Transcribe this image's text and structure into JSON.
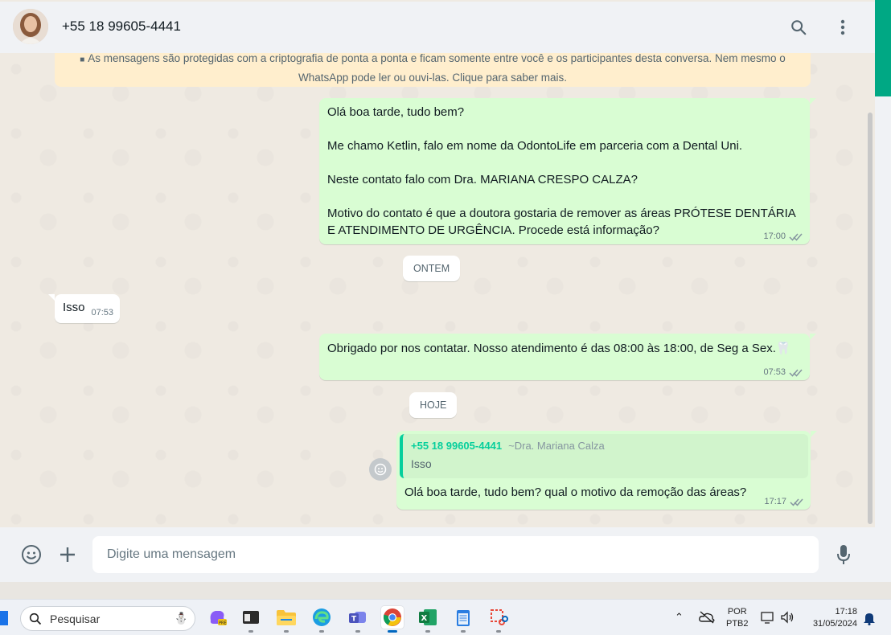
{
  "header": {
    "contact_name": "+55 18 99605-4441"
  },
  "encryption_notice": {
    "line1": "As mensagens são protegidas com a criptografia de ponta a ponta e ficam somente entre você e os participantes desta conversa. Nem mesmo o",
    "line2": "WhatsApp pode ler ou ouvi-las. Clique para saber mais."
  },
  "messages": {
    "m1": {
      "p1": "Olá boa tarde, tudo bem?",
      "p2": "Me chamo Ketlin, falo em nome da OdontoLife em parceria com a Dental Uni.",
      "p3": "Neste contato falo com Dra. MARIANA CRESPO CALZA?",
      "p4": "Motivo do contato é que a doutora gostaria de remover as áreas PRÓTESE DENTÁRIA E ATENDIMENTO DE URGÊNCIA. Procede está informação?",
      "time": "17:00"
    },
    "date1": "ONTEM",
    "m2": {
      "text": "Isso",
      "time": "07:53"
    },
    "m3": {
      "text": "Obrigado por nos contatar. Nosso atendimento é das 08:00 às 18:00, de Seg a Sex.",
      "emoji": "🦷",
      "time": "07:53"
    },
    "date2": "HOJE",
    "m4": {
      "quote_author": "+55 18 99605-4441",
      "quote_alias": "~Dra. Mariana Calza",
      "quote_text": "Isso",
      "text": "Olá boa tarde, tudo bem? qual o motivo da remoção das áreas?",
      "time": "17:17"
    }
  },
  "composer": {
    "placeholder": "Digite uma mensagem"
  },
  "taskbar": {
    "search_label": "Pesquisar",
    "lang_top": "POR",
    "lang_bottom": "PTB2",
    "clock_time": "17:18",
    "clock_date": "31/05/2024"
  },
  "colors": {
    "accent": "#00a884",
    "outgoing_bubble": "#d9fdd3",
    "incoming_bubble": "#ffffff",
    "notice_bg": "#ffeecd",
    "tick_read": "#53bdeb"
  }
}
